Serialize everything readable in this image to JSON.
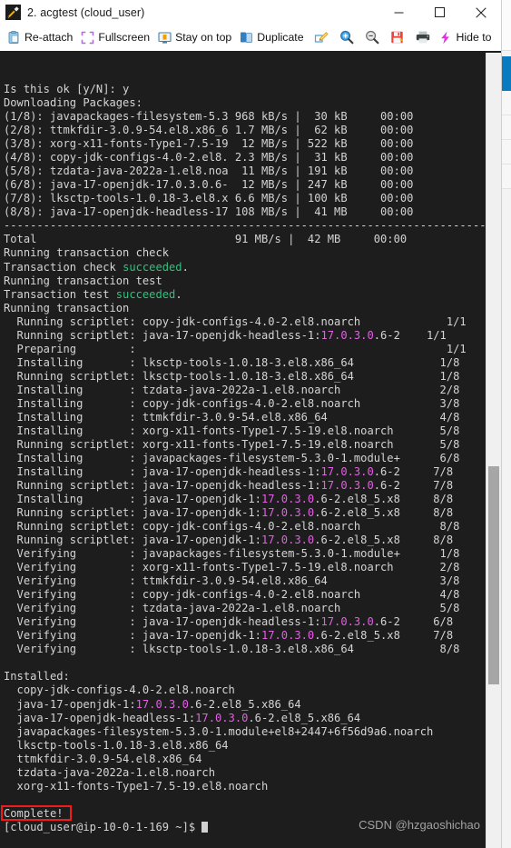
{
  "window": {
    "title": "2. acgtest (cloud_user)",
    "app_icon": "putty-icon",
    "minimize_label": "—",
    "maximize_label": "☐",
    "close_label": "✕"
  },
  "toolbar": {
    "items": [
      {
        "label": "Re-attach",
        "icon": "reattach-icon"
      },
      {
        "label": "Fullscreen",
        "icon": "fullscreen-icon"
      },
      {
        "label": "Stay on top",
        "icon": "stay-on-top-icon"
      },
      {
        "label": "Duplicate",
        "icon": "duplicate-icon"
      }
    ],
    "icon_buttons": [
      {
        "name": "edit-icon"
      },
      {
        "name": "zoom-in-icon"
      },
      {
        "name": "zoom-out-icon"
      },
      {
        "name": "save-icon"
      },
      {
        "name": "print-icon"
      }
    ],
    "hide_toolbar": {
      "label": "Hide to",
      "icon": "lightning-bolt-icon"
    }
  },
  "terminal": {
    "watermark": "CSDN @hzgaoshichao",
    "colors": {
      "background": "#1d1d1d",
      "foreground": "#d4d4d4",
      "green": "#2fc27e",
      "magenta": "#e35fe3",
      "highlight_box": "#f01c1c"
    },
    "highlight_text": "Complete!",
    "lines": [
      {
        "t": "Is this ok [y/N]: y"
      },
      {
        "t": "Downloading Packages:"
      },
      {
        "t": "(1/8): javapackages-filesystem-5.3 968 kB/s |  30 kB     00:00"
      },
      {
        "t": "(2/8): ttmkfdir-3.0.9-54.el8.x86_6 1.7 MB/s |  62 kB     00:00"
      },
      {
        "t": "(3/8): xorg-x11-fonts-Type1-7.5-19  12 MB/s | 522 kB     00:00"
      },
      {
        "t": "(4/8): copy-jdk-configs-4.0-2.el8. 2.3 MB/s |  31 kB     00:00"
      },
      {
        "t": "(5/8): tzdata-java-2022a-1.el8.noa  11 MB/s | 191 kB     00:00"
      },
      {
        "t": "(6/8): java-17-openjdk-17.0.3.0.6-  12 MB/s | 247 kB     00:00"
      },
      {
        "t": "(7/8): lksctp-tools-1.0.18-3.el8.x 6.6 MB/s | 100 kB     00:00"
      },
      {
        "t": "(8/8): java-17-openjdk-headless-17 108 MB/s |  41 MB     00:00"
      },
      {
        "t": "--------------------------------------------------------------------------------"
      },
      {
        "t": "Total                              91 MB/s |  42 MB     00:00"
      },
      {
        "t": "Running transaction check"
      },
      {
        "p": [
          {
            "t": "Transaction check "
          },
          {
            "t": "succeeded",
            "c": "green"
          },
          {
            "t": "."
          }
        ]
      },
      {
        "t": "Running transaction test"
      },
      {
        "p": [
          {
            "t": "Transaction test "
          },
          {
            "t": "succeeded",
            "c": "green"
          },
          {
            "t": "."
          }
        ]
      },
      {
        "t": "Running transaction"
      },
      {
        "t": "  Running scriptlet: copy-jdk-configs-4.0-2.el8.noarch             1/1"
      },
      {
        "p": [
          {
            "t": "  Running scriptlet: java-17-openjdk-headless-1:"
          },
          {
            "t": "17.0.3.0",
            "c": "magenta"
          },
          {
            "t": ".6-2    1/1"
          }
        ]
      },
      {
        "t": "  Preparing        :                                               1/1"
      },
      {
        "t": "  Installing       : lksctp-tools-1.0.18-3.el8.x86_64             1/8"
      },
      {
        "t": "  Running scriptlet: lksctp-tools-1.0.18-3.el8.x86_64             1/8"
      },
      {
        "t": "  Installing       : tzdata-java-2022a-1.el8.noarch               2/8"
      },
      {
        "t": "  Installing       : copy-jdk-configs-4.0-2.el8.noarch            3/8"
      },
      {
        "t": "  Installing       : ttmkfdir-3.0.9-54.el8.x86_64                 4/8"
      },
      {
        "t": "  Installing       : xorg-x11-fonts-Type1-7.5-19.el8.noarch       5/8"
      },
      {
        "t": "  Running scriptlet: xorg-x11-fonts-Type1-7.5-19.el8.noarch       5/8"
      },
      {
        "t": "  Installing       : javapackages-filesystem-5.3.0-1.module+      6/8"
      },
      {
        "p": [
          {
            "t": "  Installing       : java-17-openjdk-headless-1:"
          },
          {
            "t": "17.0.3.0",
            "c": "magenta"
          },
          {
            "t": ".6-2     7/8"
          }
        ]
      },
      {
        "p": [
          {
            "t": "  Running scriptlet: java-17-openjdk-headless-1:"
          },
          {
            "t": "17.0.3.0",
            "c": "magenta"
          },
          {
            "t": ".6-2     7/8"
          }
        ]
      },
      {
        "p": [
          {
            "t": "  Installing       : java-17-openjdk-1:"
          },
          {
            "t": "17.0.3.0",
            "c": "magenta"
          },
          {
            "t": ".6-2.el8_5.x8     8/8"
          }
        ]
      },
      {
        "p": [
          {
            "t": "  Running scriptlet: java-17-openjdk-1:"
          },
          {
            "t": "17.0.3.0",
            "c": "magenta"
          },
          {
            "t": ".6-2.el8_5.x8     8/8"
          }
        ]
      },
      {
        "t": "  Running scriptlet: copy-jdk-configs-4.0-2.el8.noarch            8/8"
      },
      {
        "p": [
          {
            "t": "  Running scriptlet: java-17-openjdk-1:"
          },
          {
            "t": "17.0.3.0",
            "c": "magenta"
          },
          {
            "t": ".6-2.el8_5.x8     8/8"
          }
        ]
      },
      {
        "t": "  Verifying        : javapackages-filesystem-5.3.0-1.module+      1/8"
      },
      {
        "t": "  Verifying        : xorg-x11-fonts-Type1-7.5-19.el8.noarch       2/8"
      },
      {
        "t": "  Verifying        : ttmkfdir-3.0.9-54.el8.x86_64                 3/8"
      },
      {
        "t": "  Verifying        : copy-jdk-configs-4.0-2.el8.noarch            4/8"
      },
      {
        "t": "  Verifying        : tzdata-java-2022a-1.el8.noarch               5/8"
      },
      {
        "p": [
          {
            "t": "  Verifying        : java-17-openjdk-headless-1:"
          },
          {
            "t": "17.0.3.0",
            "c": "magenta"
          },
          {
            "t": ".6-2     6/8"
          }
        ]
      },
      {
        "p": [
          {
            "t": "  Verifying        : java-17-openjdk-1:"
          },
          {
            "t": "17.0.3.0",
            "c": "magenta"
          },
          {
            "t": ".6-2.el8_5.x8     7/8"
          }
        ]
      },
      {
        "t": "  Verifying        : lksctp-tools-1.0.18-3.el8.x86_64             8/8"
      },
      {
        "t": ""
      },
      {
        "t": "Installed:"
      },
      {
        "t": "  copy-jdk-configs-4.0-2.el8.noarch"
      },
      {
        "p": [
          {
            "t": "  java-17-openjdk-1:"
          },
          {
            "t": "17.0.3.0",
            "c": "magenta"
          },
          {
            "t": ".6-2.el8_5.x86_64"
          }
        ]
      },
      {
        "p": [
          {
            "t": "  java-17-openjdk-headless-1:"
          },
          {
            "t": "17.0.3.0",
            "c": "magenta"
          },
          {
            "t": ".6-2.el8_5.x86_64"
          }
        ]
      },
      {
        "t": "  javapackages-filesystem-5.3.0-1.module+el8+2447+6f56d9a6.noarch"
      },
      {
        "t": "  lksctp-tools-1.0.18-3.el8.x86_64"
      },
      {
        "t": "  ttmkfdir-3.0.9-54.el8.x86_64"
      },
      {
        "t": "  tzdata-java-2022a-1.el8.noarch"
      },
      {
        "t": "  xorg-x11-fonts-Type1-7.5-19.el8.noarch"
      },
      {
        "t": ""
      },
      {
        "t": "Complete!",
        "hl": true
      }
    ]
  }
}
